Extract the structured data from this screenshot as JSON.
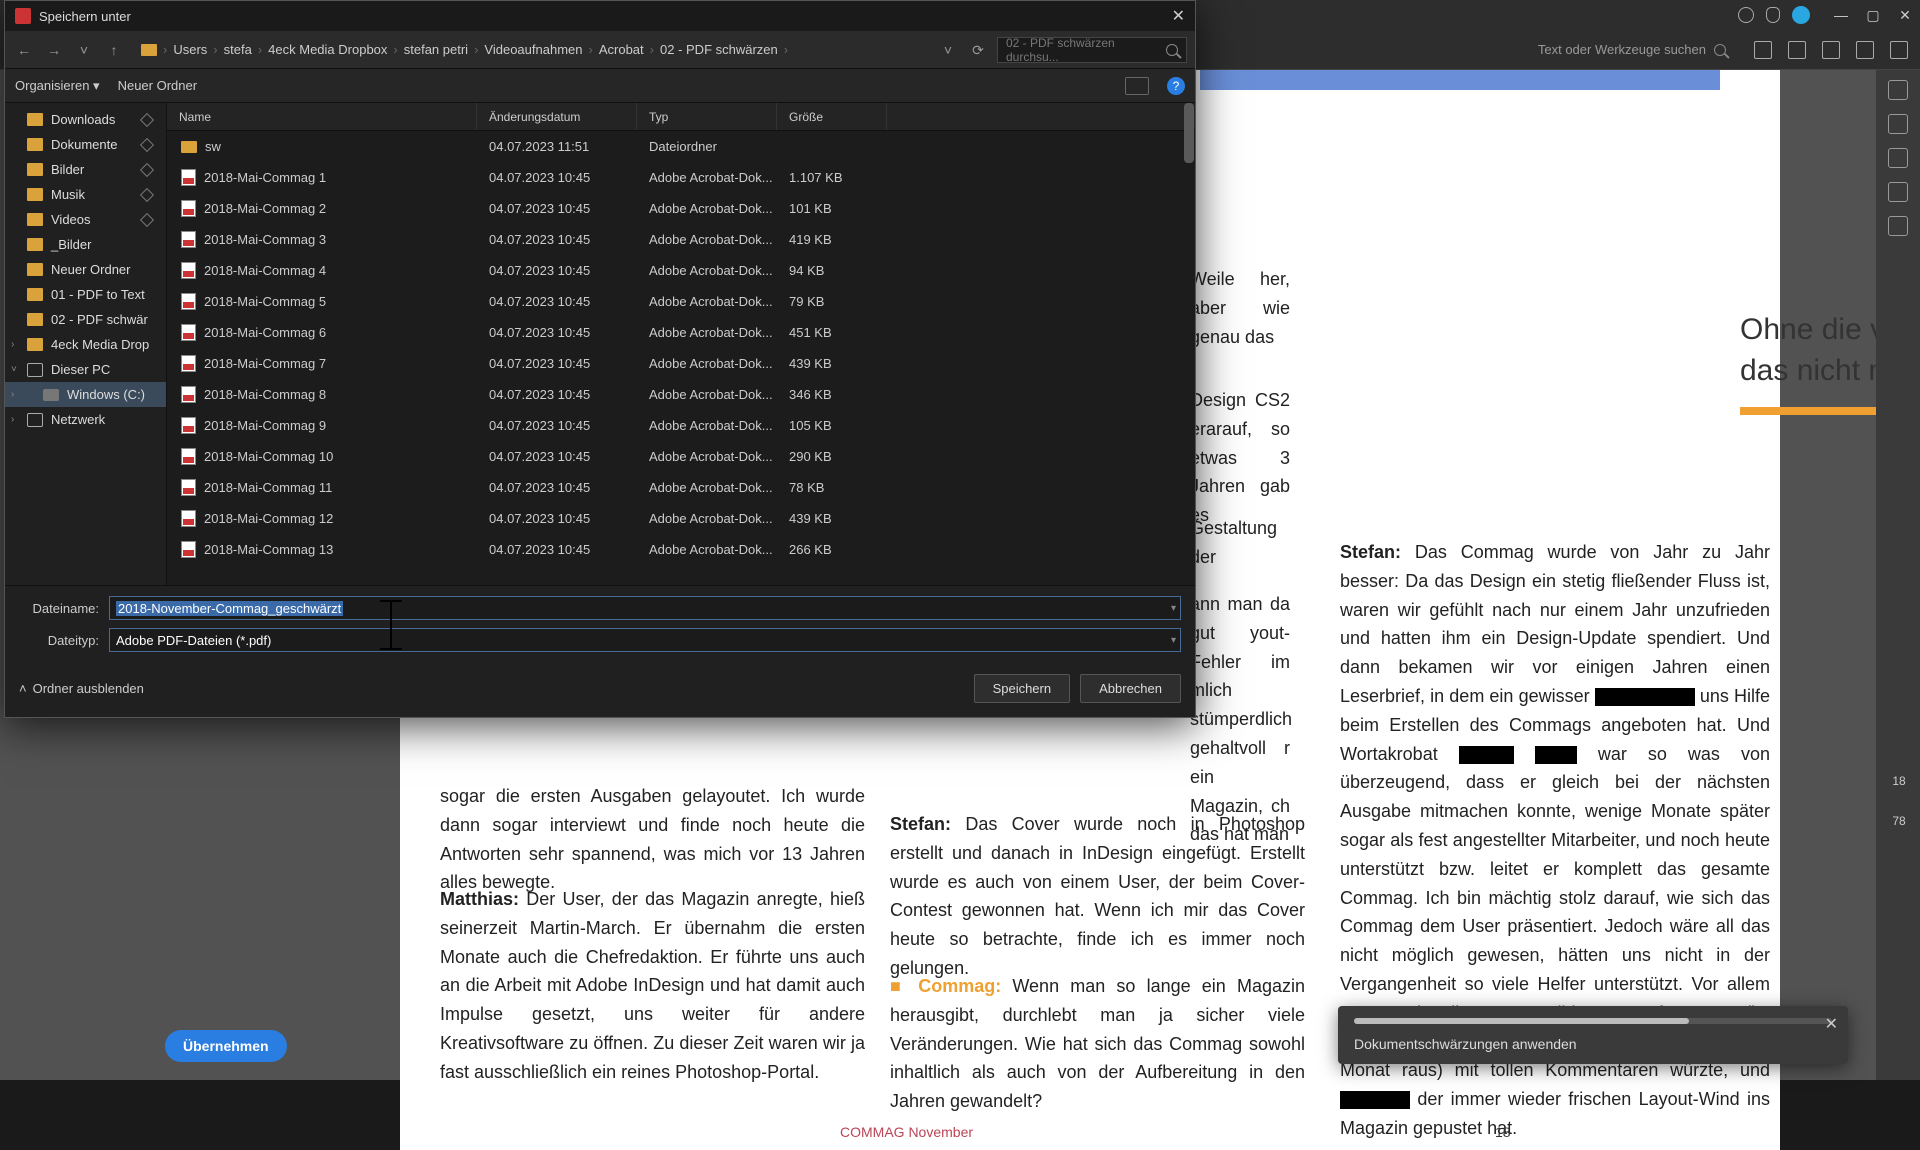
{
  "acrobat": {
    "search_placeholder": "Text oder Werkzeuge suchen",
    "apply_button": "Übernehmen",
    "page_indicator_1": "18",
    "page_indicator_2": "78"
  },
  "toast": {
    "message": "Dokumentschwärzungen anwenden"
  },
  "document": {
    "pull_quote": "Ohne die vielen Helfer wäre all das nicht möglich gewesen.",
    "col1_partial_top": "Weile her, aber wie genau das",
    "col1_partial_mid": "Design CS2 erarauf, so etwas 3 Jahren gab es",
    "col1_partial_mid2": "Gestaltung der",
    "col1_partial_bot": "ann man da gut yout-Fehler im mlich stümperdlich gehaltvoll r ein Magazin, ch das hat man",
    "col1_text": "sogar die ersten Ausgaben gelayoutet. Ich wurde dann sogar interviewt und finde noch heute die Antworten sehr spannend, was mich vor 13 Jahren alles bewegte.",
    "col1_matthias": "Matthias:",
    "col1_text2": " Der User, der das Magazin anregte, hieß seinerzeit Martin-March. Er übernahm die ersten Monate auch die Chefredaktion. Er führte uns auch an die Arbeit mit Adobe InDesign und hat damit auch Impulse gesetzt, uns weiter für andere Kreativsoftware zu öffnen. Zu dieser Zeit waren wir ja fast ausschließlich ein reines Photoshop-Portal.",
    "col2_stefan": "Stefan:",
    "col2_text": " Das Cover wurde noch in Photoshop erstellt und danach in InDesign eingefügt. Erstellt wurde es auch von einem User, der beim Cover-Contest gewonnen hat. Wenn ich mir das Cover heute so betrachte, finde ich es immer noch gelungen.",
    "col2_commag": "Commag:",
    "col2_text2": " Wenn man so lange ein Magazin herausgibt, durchlebt man ja sicher viele Veränderungen. Wie hat sich das Commag sowohl inhaltlich als auch von der Aufbereitung in den Jahren gewandelt?",
    "col3_stefan": "Stefan:",
    "col3_text": " Das Commag wurde von Jahr zu Jahr besser: Da das Design ein stetig fließender Fluss ist, waren wir gefühlt nach nur einem Jahr unzufrieden und hatten ihm ein Design-Update spendiert. Und dann bekamen wir vor einigen Jahren einen Leserbrief, in dem ein gewisser ",
    "col3_text_b": " uns Hilfe beim Erstellen des Commags angeboten hat. Und Wortakrobat ",
    "col3_text_c": " war so was von überzeugend, dass er gleich bei der nächsten Ausgabe mitmachen konnte, wenige Monate später sogar als fest angestellter Mitarbeiter, und noch heute unterstützt bzw. leitet er komplett das gesamte Commag. Ich bin mächtig stolz darauf, wie sich das Commag dem User präsentiert. Jedoch wäre all das nicht möglich gewesen, hätten uns nicht in der Vergangenheit so viele Helfer unterstützt. Vor allem pepexx, der die Contest-Bilder Monat für Monat (ja, vor nicht allzu langer Zeit kam das Commag jeden Monat raus) mit tollen Kommentaren würzte, und ",
    "col3_text_d": " der immer wieder frischen Layout-Wind ins Magazin gepustet hat.",
    "footer_mag": "COMMAG November",
    "footer_page": "18"
  },
  "dialog": {
    "title": "Speichern unter",
    "breadcrumb": [
      "Users",
      "stefa",
      "4eck Media Dropbox",
      "stefan petri",
      "Videoaufnahmen",
      "Acrobat",
      "02 - PDF schwärzen"
    ],
    "search_placeholder": "02 - PDF schwärzen durchsu...",
    "organize": "Organisieren",
    "new_folder": "Neuer Ordner",
    "tree": [
      {
        "label": "Downloads",
        "pin": true,
        "icon": "folder"
      },
      {
        "label": "Dokumente",
        "pin": true,
        "icon": "folder"
      },
      {
        "label": "Bilder",
        "pin": true,
        "icon": "folder"
      },
      {
        "label": "Musik",
        "pin": true,
        "icon": "folder"
      },
      {
        "label": "Videos",
        "pin": true,
        "icon": "folder"
      },
      {
        "label": "_Bilder",
        "icon": "folder"
      },
      {
        "label": "Neuer Ordner",
        "icon": "folder"
      },
      {
        "label": "01 - PDF to Text",
        "icon": "folder"
      },
      {
        "label": "02 - PDF schwär",
        "icon": "folder"
      },
      {
        "label": "4eck Media Drop",
        "icon": "dropbox",
        "chev": ">"
      },
      {
        "label": "Dieser PC",
        "icon": "pc",
        "chev": "v"
      },
      {
        "label": "Windows (C:)",
        "icon": "drive",
        "chev": ">",
        "sel": true,
        "indent": true
      },
      {
        "label": "Netzwerk",
        "icon": "net",
        "chev": ">"
      }
    ],
    "columns": {
      "name": "Name",
      "date": "Änderungsdatum",
      "type": "Typ",
      "size": "Größe"
    },
    "rows": [
      {
        "name": "sw",
        "date": "04.07.2023 11:51",
        "type": "Dateiordner",
        "size": "",
        "folder": true
      },
      {
        "name": "2018-Mai-Commag 1",
        "date": "04.07.2023 10:45",
        "type": "Adobe Acrobat-Dok...",
        "size": "1.107 KB"
      },
      {
        "name": "2018-Mai-Commag 2",
        "date": "04.07.2023 10:45",
        "type": "Adobe Acrobat-Dok...",
        "size": "101 KB"
      },
      {
        "name": "2018-Mai-Commag 3",
        "date": "04.07.2023 10:45",
        "type": "Adobe Acrobat-Dok...",
        "size": "419 KB"
      },
      {
        "name": "2018-Mai-Commag 4",
        "date": "04.07.2023 10:45",
        "type": "Adobe Acrobat-Dok...",
        "size": "94 KB"
      },
      {
        "name": "2018-Mai-Commag 5",
        "date": "04.07.2023 10:45",
        "type": "Adobe Acrobat-Dok...",
        "size": "79 KB"
      },
      {
        "name": "2018-Mai-Commag 6",
        "date": "04.07.2023 10:45",
        "type": "Adobe Acrobat-Dok...",
        "size": "451 KB"
      },
      {
        "name": "2018-Mai-Commag 7",
        "date": "04.07.2023 10:45",
        "type": "Adobe Acrobat-Dok...",
        "size": "439 KB"
      },
      {
        "name": "2018-Mai-Commag 8",
        "date": "04.07.2023 10:45",
        "type": "Adobe Acrobat-Dok...",
        "size": "346 KB"
      },
      {
        "name": "2018-Mai-Commag 9",
        "date": "04.07.2023 10:45",
        "type": "Adobe Acrobat-Dok...",
        "size": "105 KB"
      },
      {
        "name": "2018-Mai-Commag 10",
        "date": "04.07.2023 10:45",
        "type": "Adobe Acrobat-Dok...",
        "size": "290 KB"
      },
      {
        "name": "2018-Mai-Commag 11",
        "date": "04.07.2023 10:45",
        "type": "Adobe Acrobat-Dok...",
        "size": "78 KB"
      },
      {
        "name": "2018-Mai-Commag 12",
        "date": "04.07.2023 10:45",
        "type": "Adobe Acrobat-Dok...",
        "size": "439 KB"
      },
      {
        "name": "2018-Mai-Commag 13",
        "date": "04.07.2023 10:45",
        "type": "Adobe Acrobat-Dok...",
        "size": "266 KB"
      }
    ],
    "filename_label": "Dateiname:",
    "filename_value": "2018-November-Commag_geschwärzt",
    "filetype_label": "Dateityp:",
    "filetype_value": "Adobe PDF-Dateien (*.pdf)",
    "hide_folders": "Ordner ausblenden",
    "save": "Speichern",
    "cancel": "Abbrechen"
  }
}
